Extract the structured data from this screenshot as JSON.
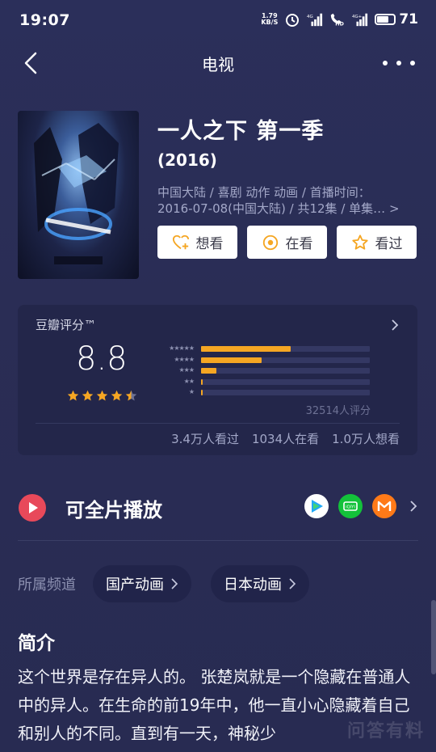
{
  "status_bar": {
    "time": "19:07",
    "net_speed_value": "1.79",
    "net_speed_unit": "KB/S",
    "signal1_label": "4G",
    "hd_label": "HD",
    "signal2_label": "4G+",
    "battery": "71"
  },
  "nav": {
    "title": "电视"
  },
  "show": {
    "title": "一人之下 第一季",
    "year": "(2016)",
    "meta_line1": "中国大陆 / 喜剧 动作 动画 / 首播时间：",
    "meta_line2": "2016-07-08(中国大陆) / 共12集 / 单集…",
    "meta_more": ">"
  },
  "actions": [
    {
      "label": "想看",
      "icon": "heart-plus-icon"
    },
    {
      "label": "在看",
      "icon": "target-icon"
    },
    {
      "label": "看过",
      "icon": "star-outline-icon"
    }
  ],
  "rating": {
    "label": "豆瓣评分™",
    "score": "8.8",
    "stars": 4.5,
    "distribution": [
      {
        "stars": "★★★★★",
        "fraction": 0.53
      },
      {
        "stars": "★★★★",
        "fraction": 0.36
      },
      {
        "stars": "★★★",
        "fraction": 0.09
      },
      {
        "stars": "★★",
        "fraction": 0.01
      },
      {
        "stars": "★",
        "fraction": 0.01
      }
    ],
    "count": "32514人评分",
    "watched": "3.4万人看过",
    "watching": "1034人在看",
    "want": "1.0万人想看"
  },
  "play": {
    "label": "可全片播放",
    "platforms": [
      "tencent-video-icon",
      "iqiyi-icon",
      "mango-tv-icon"
    ],
    "iqiyi_text": "iQIYI"
  },
  "channels": {
    "label": "所属频道",
    "items": [
      {
        "label": "国产动画"
      },
      {
        "label": "日本动画"
      }
    ]
  },
  "intro": {
    "title": "简介",
    "text": "这个世界是存在异人的。 张楚岚就是一个隐藏在普通人中的异人。在生命的前19年中，他一直小心隐藏着自己和别人的不同。直到有一天，神秘少"
  },
  "watermark": "问答有料",
  "colors": {
    "background": "#2a2d55",
    "accent": "#f5a623",
    "play_red": "#e8495a"
  }
}
